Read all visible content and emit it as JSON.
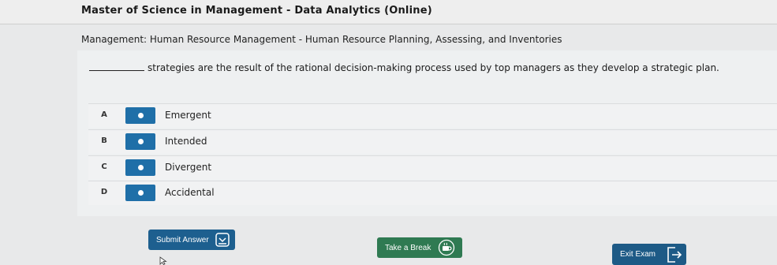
{
  "header": {
    "program_title": "Master of Science in Management - Data Analytics (Online)"
  },
  "course": {
    "line": "Management: Human Resource Management - Human Resource Planning, Assessing, and Inventories"
  },
  "question": {
    "text": "strategies are the result of the rational decision-making process used by top managers as they develop a strategic plan."
  },
  "options": [
    {
      "letter": "A",
      "text": "Emergent"
    },
    {
      "letter": "B",
      "text": "Intended"
    },
    {
      "letter": "C",
      "text": "Divergent"
    },
    {
      "letter": "D",
      "text": "Accidental"
    }
  ],
  "buttons": {
    "submit_label": "Submit Answer",
    "break_label": "Take a Break",
    "exit_label": "Exit Exam"
  },
  "colors": {
    "radio": "#1f6fa8",
    "submit": "#1d5f8f",
    "break": "#2f7a52",
    "exit": "#1d5a86"
  }
}
